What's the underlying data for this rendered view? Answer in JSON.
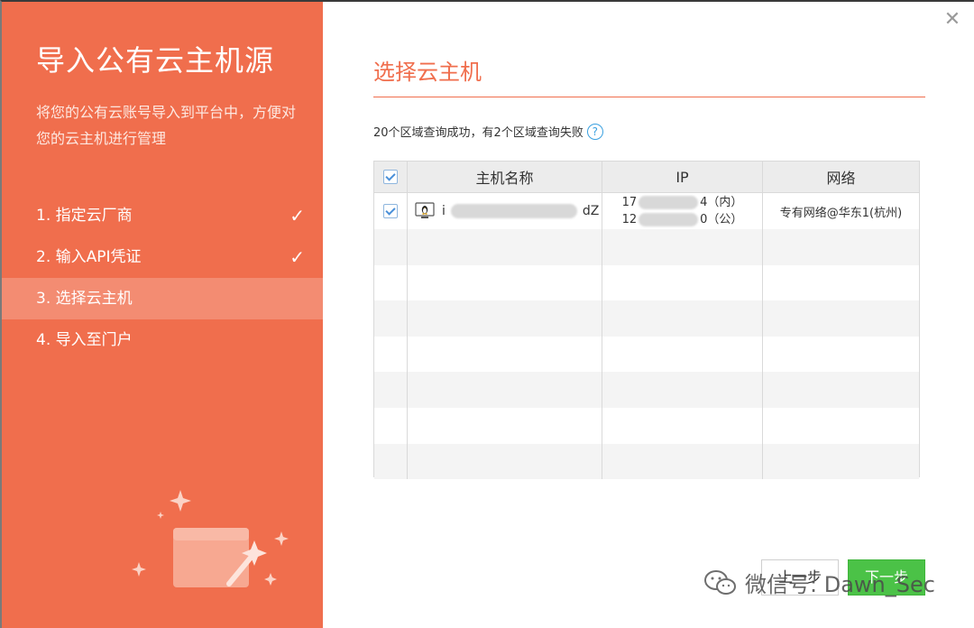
{
  "sidebar": {
    "title": "导入公有云主机源",
    "description": "将您的公有云账号导入到平台中，方便对您的云主机进行管理",
    "steps": [
      {
        "label": "1. 指定云厂商",
        "done": true
      },
      {
        "label": "2. 输入API凭证",
        "done": true
      },
      {
        "label": "3. 选择云主机",
        "done": false
      },
      {
        "label": "4. 导入至门户",
        "done": false
      }
    ],
    "check_glyph": "✓"
  },
  "main": {
    "title": "选择云主机",
    "summary": "20个区域查询成功，有2个区域查询失败",
    "help_glyph": "?",
    "close_glyph": "✕"
  },
  "table": {
    "headers": {
      "host": "主机名称",
      "ip": "IP",
      "network": "网络"
    },
    "rows": [
      {
        "checked": true,
        "host_prefix": "i",
        "host_suffix": "dZ",
        "ip_inner_prefix": "17",
        "ip_inner_suffix": "4（内）",
        "ip_public_prefix": "12",
        "ip_public_suffix": "0（公）",
        "network": "专有网络@华东1(杭州)"
      }
    ]
  },
  "buttons": {
    "prev": "上一步",
    "next": "下一步"
  },
  "watermark": {
    "text": "微信号: Dawn_Sec"
  },
  "colors": {
    "accent": "#f06e4d",
    "active_step": "#f38c72",
    "next_button": "#4bc247"
  }
}
